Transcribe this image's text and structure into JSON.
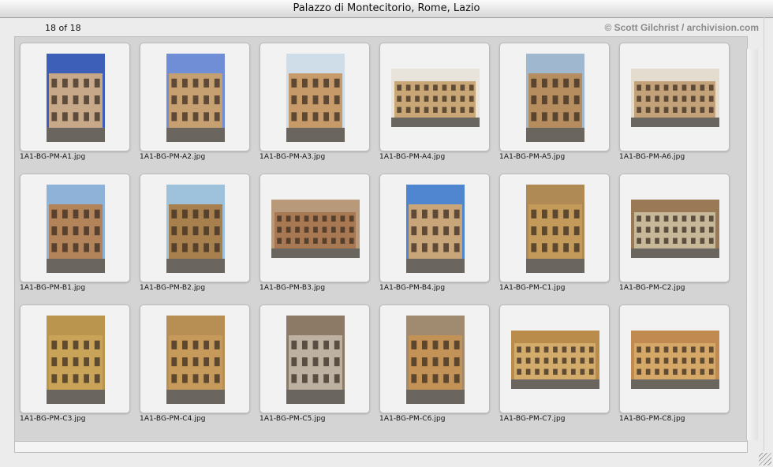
{
  "window": {
    "title": "Palazzo di Montecitorio, Rome, Lazio"
  },
  "header": {
    "count": "18 of 18",
    "credit": "© Scott Gilchrist / archivision.com"
  },
  "thumbnails": [
    {
      "filename": "1A1-BG-PM-A1.jpg",
      "sky": "#3d5fb8",
      "wall": "#c7a98a",
      "orientation": "portrait"
    },
    {
      "filename": "1A1-BG-PM-A2.jpg",
      "sky": "#6f8ed6",
      "wall": "#c7a072",
      "orientation": "portrait"
    },
    {
      "filename": "1A1-BG-PM-A3.jpg",
      "sky": "#cfdde9",
      "wall": "#c79a6a",
      "orientation": "portrait"
    },
    {
      "filename": "1A1-BG-PM-A4.jpg",
      "sky": "#e8e4dc",
      "wall": "#c9a676",
      "orientation": "landscape"
    },
    {
      "filename": "1A1-BG-PM-A5.jpg",
      "sky": "#9fb7cf",
      "wall": "#b68d5e",
      "orientation": "portrait"
    },
    {
      "filename": "1A1-BG-PM-A6.jpg",
      "sky": "#e4dccf",
      "wall": "#c3a27a",
      "orientation": "landscape"
    },
    {
      "filename": "1A1-BG-PM-B1.jpg",
      "sky": "#8fb2d8",
      "wall": "#b3845a",
      "orientation": "portrait"
    },
    {
      "filename": "1A1-BG-PM-B2.jpg",
      "sky": "#9fc2dc",
      "wall": "#a8804e",
      "orientation": "portrait"
    },
    {
      "filename": "1A1-BG-PM-B3.jpg",
      "sky": "#b89a7a",
      "wall": "#a87852",
      "orientation": "landscape"
    },
    {
      "filename": "1A1-BG-PM-B4.jpg",
      "sky": "#4f86cf",
      "wall": "#c9a57a",
      "orientation": "portrait"
    },
    {
      "filename": "1A1-BG-PM-C1.jpg",
      "sky": "#b08a54",
      "wall": "#c39a5a",
      "orientation": "portrait"
    },
    {
      "filename": "1A1-BG-PM-C2.jpg",
      "sky": "#9a7a56",
      "wall": "#c8b89a",
      "orientation": "landscape"
    },
    {
      "filename": "1A1-BG-PM-C3.jpg",
      "sky": "#b9954e",
      "wall": "#c9a458",
      "orientation": "portrait"
    },
    {
      "filename": "1A1-BG-PM-C4.jpg",
      "sky": "#b78e54",
      "wall": "#c69a5a",
      "orientation": "portrait"
    },
    {
      "filename": "1A1-BG-PM-C5.jpg",
      "sky": "#8c7a66",
      "wall": "#bdb2a2",
      "orientation": "portrait"
    },
    {
      "filename": "1A1-BG-PM-C6.jpg",
      "sky": "#a08a70",
      "wall": "#c39256",
      "orientation": "portrait"
    },
    {
      "filename": "1A1-BG-PM-C7.jpg",
      "sky": "#b98c4c",
      "wall": "#d3ac6c",
      "orientation": "landscape"
    },
    {
      "filename": "1A1-BG-PM-C8.jpg",
      "sky": "#c08a50",
      "wall": "#d6a868",
      "orientation": "landscape"
    }
  ]
}
